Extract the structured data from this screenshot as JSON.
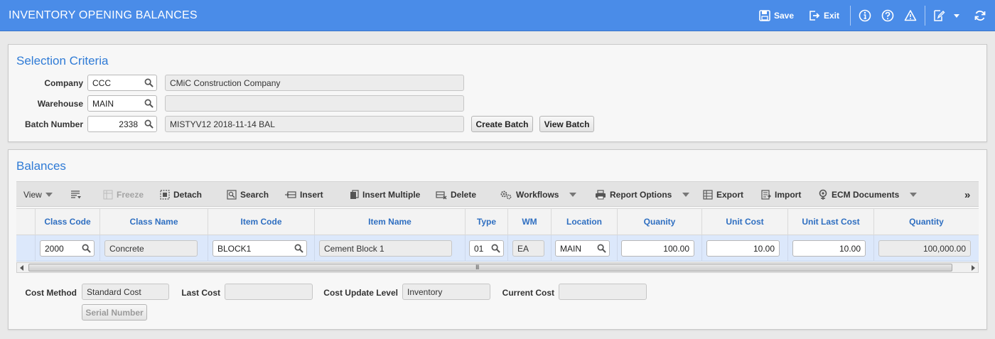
{
  "header": {
    "title": "INVENTORY OPENING BALANCES",
    "save_label": "Save",
    "exit_label": "Exit"
  },
  "selection": {
    "title": "Selection Criteria",
    "company_label": "Company",
    "company_value": "CCC",
    "company_name": "CMiC Construction Company",
    "warehouse_label": "Warehouse",
    "warehouse_value": "MAIN",
    "warehouse_name": "",
    "batch_label": "Batch Number",
    "batch_value": "2338",
    "batch_desc": "MISTYV12 2018-11-14 BAL",
    "create_batch_label": "Create Batch",
    "view_batch_label": "View Batch"
  },
  "balances": {
    "title": "Balances",
    "toolbar": {
      "view": "View",
      "freeze": "Freeze",
      "detach": "Detach",
      "search": "Search",
      "insert": "Insert",
      "insert_multiple": "Insert Multiple",
      "delete": "Delete",
      "workflows": "Workflows",
      "report_options": "Report Options",
      "export": "Export",
      "import": "Import",
      "ecm_documents": "ECM Documents"
    },
    "columns": [
      "Class Code",
      "Class Name",
      "Item Code",
      "Item Name",
      "Type",
      "WM",
      "Location",
      "Quanity",
      "Unit Cost",
      "Unit Last Cost",
      "Quantity"
    ],
    "rows": [
      {
        "class_code": "2000",
        "class_name": "Concrete",
        "item_code": "BLOCK1",
        "item_name": "Cement Block 1",
        "type": "01",
        "wm": "EA",
        "location": "MAIN",
        "quanity": "100.00",
        "unit_cost": "10.00",
        "unit_last_cost": "10.00",
        "quantity": "100,000.00"
      }
    ],
    "footer": {
      "cost_method_label": "Cost Method",
      "cost_method_value": "Standard Cost",
      "last_cost_label": "Last Cost",
      "last_cost_value": "",
      "cost_update_level_label": "Cost Update Level",
      "cost_update_level_value": "Inventory",
      "current_cost_label": "Current Cost",
      "current_cost_value": "",
      "serial_number_label": "Serial Number"
    }
  },
  "colors": {
    "header_bg": "#4a8ce8",
    "title_blue": "#2f7bd6",
    "row_selected": "#dce8fb"
  }
}
